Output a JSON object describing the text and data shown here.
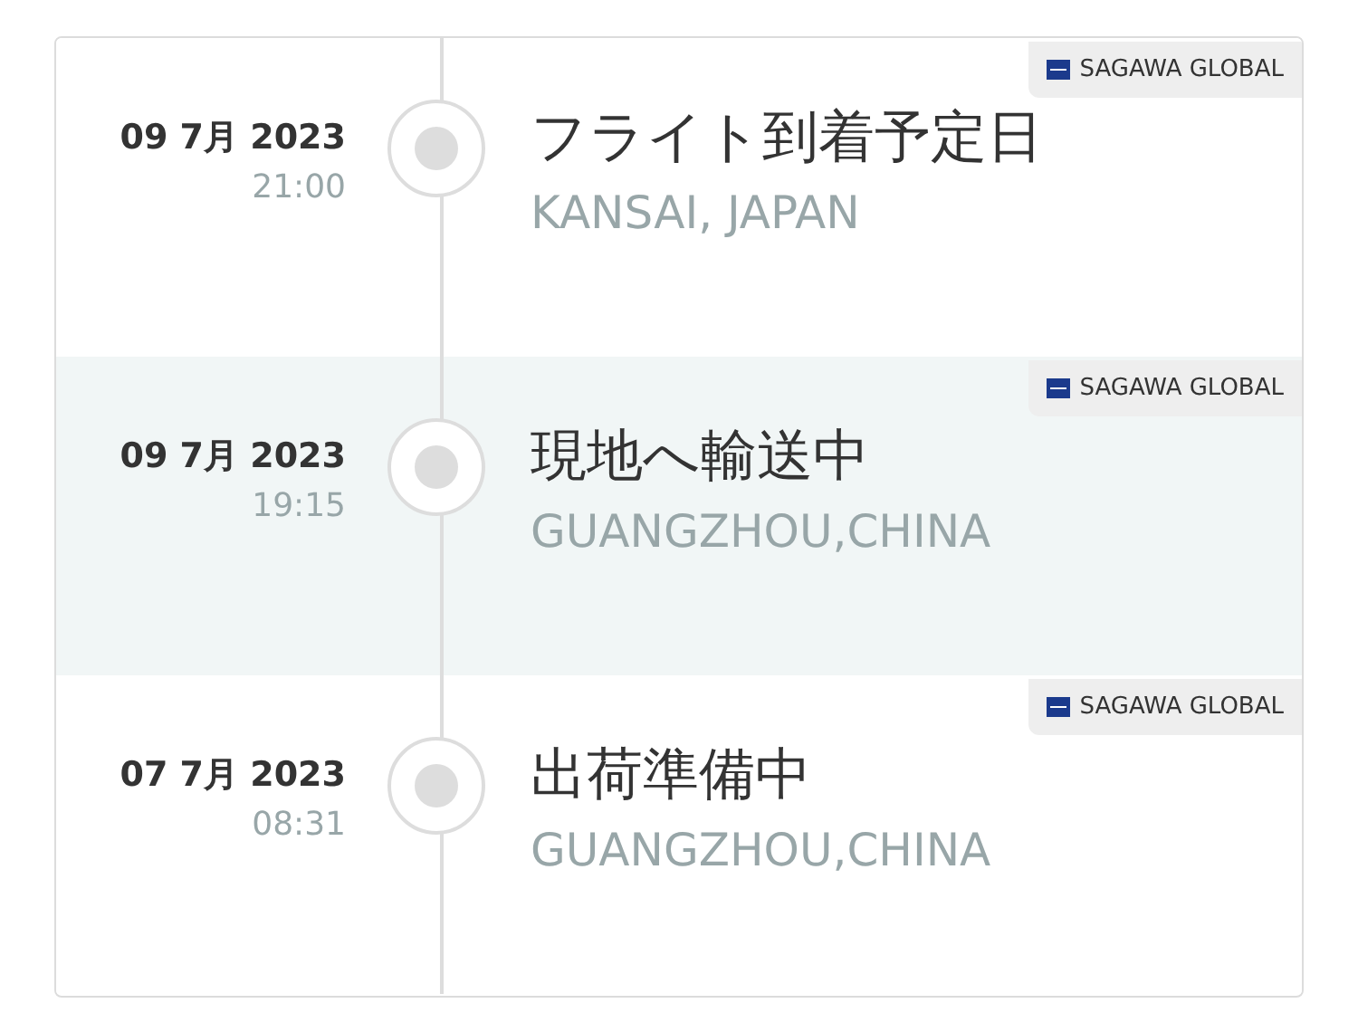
{
  "events": [
    {
      "date": "09 7月 2023",
      "time": "21:00",
      "title": "フライト到着予定日",
      "location": "KANSAI, JAPAN",
      "carrier": "SAGAWA GLOBAL",
      "highlighted": false
    },
    {
      "date": "09 7月 2023",
      "time": "19:15",
      "title": "現地へ輸送中",
      "location": "GUANGZHOU,CHINA",
      "carrier": "SAGAWA GLOBAL",
      "highlighted": true
    },
    {
      "date": "07 7月 2023",
      "time": "08:31",
      "title": "出荷準備中",
      "location": "GUANGZHOU,CHINA",
      "carrier": "SAGAWA GLOBAL",
      "highlighted": false
    }
  ]
}
